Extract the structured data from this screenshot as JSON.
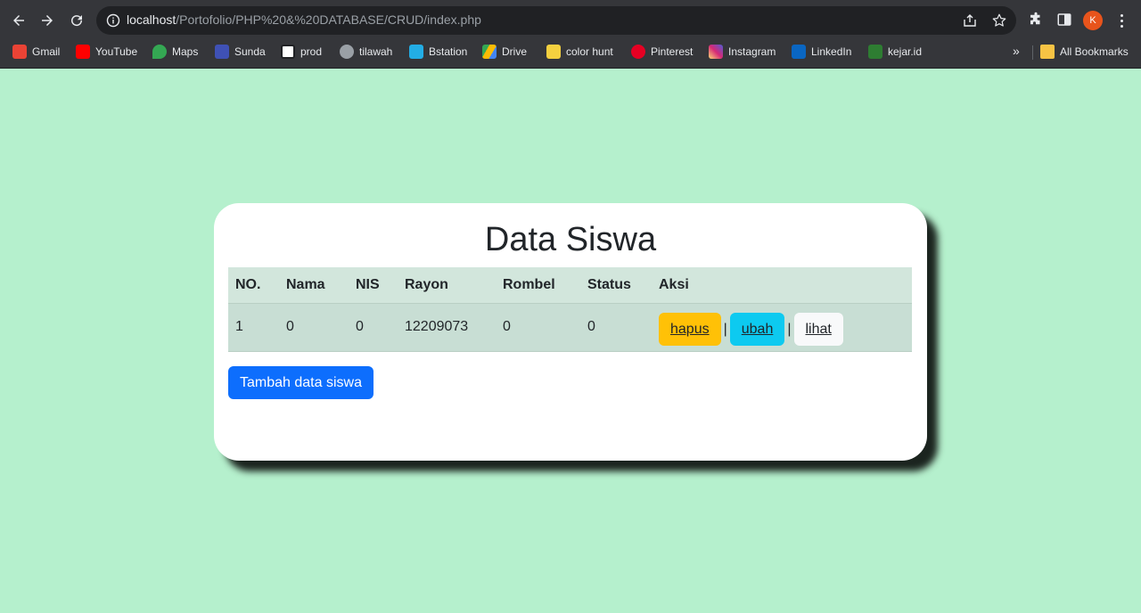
{
  "browser": {
    "url_host": "localhost",
    "url_path": "/Portofolio/PHP%20&%20DATABASE/CRUD/index.php",
    "profile_initial": "K",
    "bookmarks": [
      {
        "label": "Gmail",
        "icon": "gmail-icon",
        "color": "#ea4335"
      },
      {
        "label": "YouTube",
        "icon": "youtube-icon",
        "color": "#ff0000"
      },
      {
        "label": "Maps",
        "icon": "maps-icon",
        "color": "#34a853"
      },
      {
        "label": "Sunda",
        "icon": "sunda-icon",
        "color": "#3f51b5"
      },
      {
        "label": "prod",
        "icon": "notion-icon",
        "color": "#ffffff"
      },
      {
        "label": "tilawah",
        "icon": "tilawah-icon",
        "color": "#9aa0a6"
      },
      {
        "label": "Bstation",
        "icon": "bstation-icon",
        "color": "#23ade5"
      },
      {
        "label": "Drive",
        "icon": "drive-icon",
        "color": "#fbbc04"
      },
      {
        "label": "color hunt",
        "icon": "colorhunt-icon",
        "color": "#f4d03f"
      },
      {
        "label": "Pinterest",
        "icon": "pinterest-icon",
        "color": "#e60023"
      },
      {
        "label": "Instagram",
        "icon": "instagram-icon",
        "color": "#d62976"
      },
      {
        "label": "LinkedIn",
        "icon": "linkedin-icon",
        "color": "#0a66c2"
      },
      {
        "label": "kejar.id",
        "icon": "kejar-icon",
        "color": "#2e7d32"
      }
    ],
    "more_label": "»",
    "all_bookmarks_label": "All Bookmarks"
  },
  "page": {
    "title": "Data Siswa",
    "table": {
      "headers": [
        "NO.",
        "Nama",
        "NIS",
        "Rayon",
        "Rombel",
        "Status",
        "Aksi"
      ],
      "rows": [
        {
          "no": "1",
          "nama": "0",
          "nis": "0",
          "rayon": "12209073",
          "rombel": "0",
          "status": "0"
        }
      ],
      "actions": {
        "delete": "hapus",
        "edit": "ubah",
        "view": "lihat",
        "separator": "|"
      }
    },
    "add_button": "Tambah data siswa"
  },
  "colors": {
    "background": "#b5f0cd",
    "primary": "#0d6efd",
    "warning": "#ffc107",
    "info": "#0dcaf0",
    "light": "#f8f9fa"
  }
}
